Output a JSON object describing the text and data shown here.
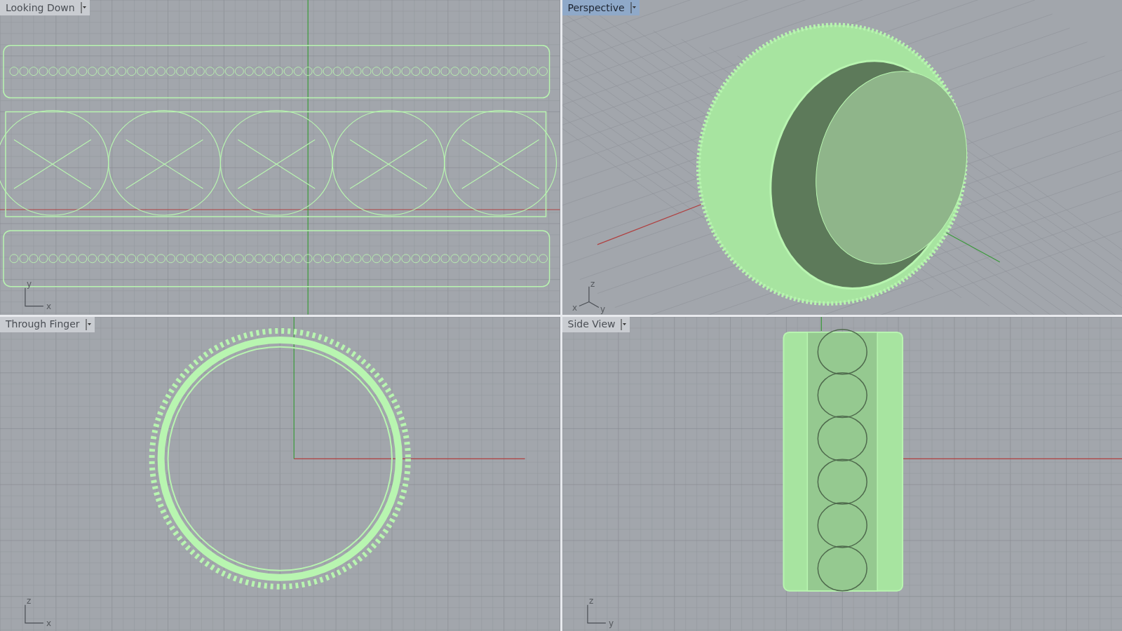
{
  "viewports": [
    {
      "title": "Looking Down",
      "selected": false,
      "kind": "top",
      "axes": [
        "y",
        "x"
      ]
    },
    {
      "title": "Perspective",
      "selected": true,
      "kind": "perspective",
      "axes": [
        "z",
        "x",
        "y"
      ]
    },
    {
      "title": "Through Finger",
      "selected": false,
      "kind": "front",
      "axes": [
        "z",
        "x"
      ]
    },
    {
      "title": "Side View",
      "selected": false,
      "kind": "side",
      "axes": [
        "z",
        "y"
      ]
    }
  ]
}
